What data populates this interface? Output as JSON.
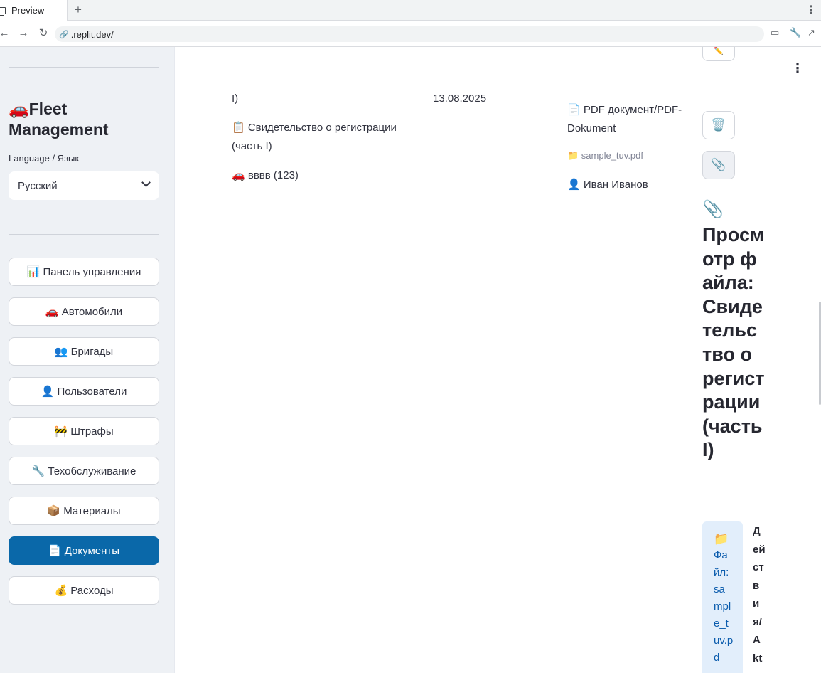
{
  "browser": {
    "tab_title": "Preview",
    "new_tab": "+",
    "url": ".replit.dev/"
  },
  "sidebar": {
    "app_title": "🚗Fleet Management",
    "language_label": "Language / Язык",
    "language_value": "Русский",
    "nav_items": [
      {
        "label": "📊 Панель управления"
      },
      {
        "label": "🚗 Автомобили"
      },
      {
        "label": "👥 Бригады"
      },
      {
        "label": "👤 Пользователи"
      },
      {
        "label": "🚧 Штрафы"
      },
      {
        "label": "🔧 Техобслуживание"
      },
      {
        "label": "📦 Материалы"
      },
      {
        "label": "📄 Документы",
        "active": true
      },
      {
        "label": "💰 Расходы"
      }
    ]
  },
  "document": {
    "title_fragment": "I)",
    "date": "13.08.2025",
    "type": "📋 Свидетельство о регистрации (часть I)",
    "vehicle": "🚗 вввв (123)",
    "format": "📄 PDF документ/PDF-Dokument",
    "file_name": "📁 sample_tuv.pdf",
    "owner": "👤 Иван Иванов"
  },
  "actions": {
    "edit_icon": "pencil-icon",
    "delete_icon": "🗑️",
    "attach_icon": "📎"
  },
  "preview": {
    "icon": "📎",
    "heading": "Просмотр файла: Свидетельство о регистрации (часть I)",
    "file_box_icon": "📁",
    "file_box_text": "Файл: sample_tuv.pd",
    "actions_label": "Действия/Akt"
  }
}
